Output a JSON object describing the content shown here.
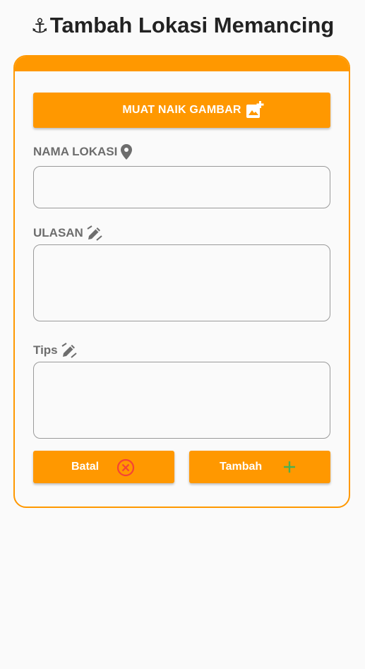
{
  "header": {
    "title": "Tambah Lokasi Memancing",
    "icon": "anchor-icon"
  },
  "form": {
    "upload_label": "MUAT NAIK GAMBAR",
    "name_label": "NAMA LOKASI",
    "name_value": "",
    "review_label": "ULASAN",
    "review_value": "",
    "tips_label": "Tips",
    "tips_value": ""
  },
  "actions": {
    "cancel_label": "Batal",
    "add_label": "Tambah"
  },
  "colors": {
    "accent": "#ff9800",
    "cancel": "#f44336",
    "add": "#4caf50",
    "label": "#6d6d6d"
  }
}
